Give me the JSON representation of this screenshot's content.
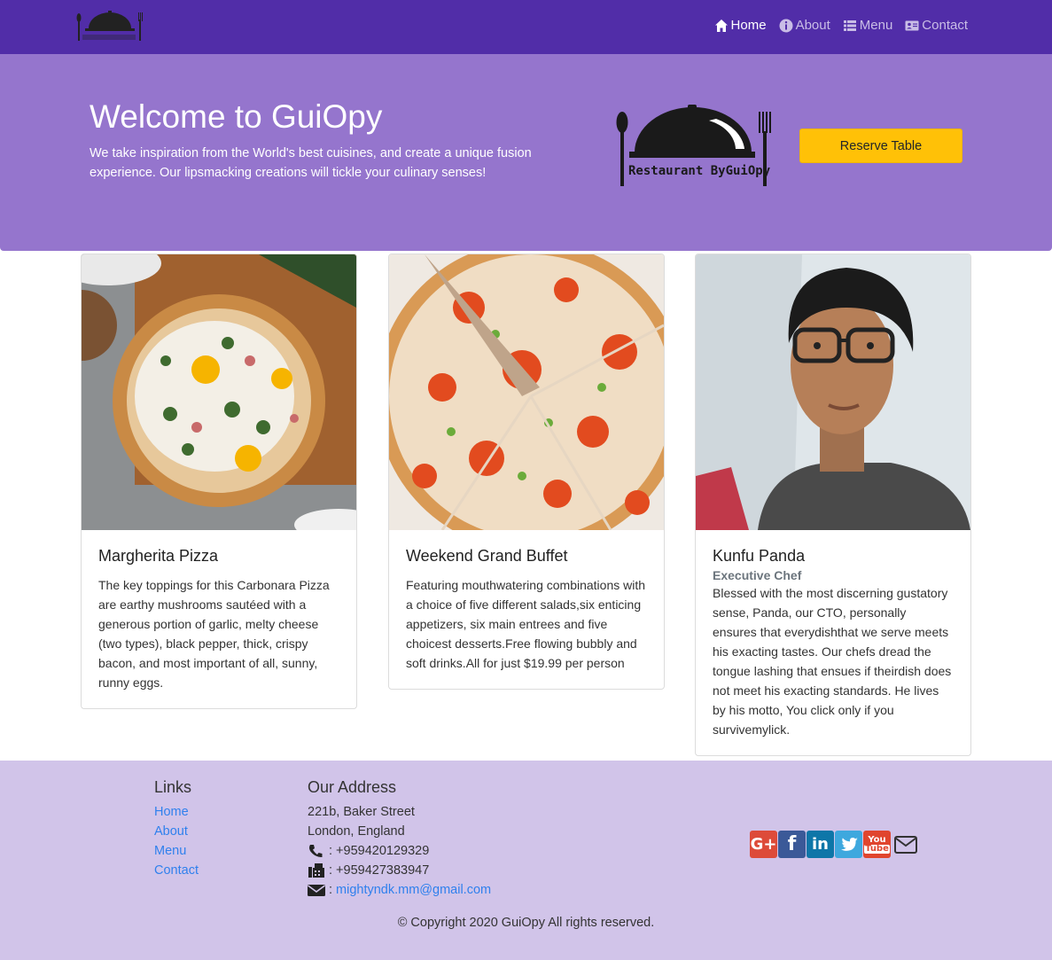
{
  "nav": {
    "brand_alt": "Restaurant ByGuiOpy",
    "items": [
      {
        "label": "Home",
        "icon": "home-icon",
        "active": true
      },
      {
        "label": "About",
        "icon": "info-icon"
      },
      {
        "label": "Menu",
        "icon": "list-icon"
      },
      {
        "label": "Contact",
        "icon": "address-card-icon"
      }
    ]
  },
  "jumbotron": {
    "title": "Welcome to GuiOpy",
    "text": "We take inspiration from the World's best cuisines, and create a unique fusion experience. Our lipsmacking creations will tickle your culinary senses!",
    "logo_text": "Restaurant ByGuiOpy",
    "button_label": "Reserve Table"
  },
  "cards": [
    {
      "title": "Margherita Pizza",
      "subtitle": "",
      "text": "The key toppings for this Carbonara Pizza are earthy mushrooms sautéed with a generous portion of garlic, melty cheese (two types), black pepper, thick, crispy bacon, and most important of all, sunny, runny eggs."
    },
    {
      "title": "Weekend Grand Buffet",
      "subtitle": "",
      "text": "Featuring mouthwatering combinations with a choice of five different salads,six enticing appetizers, six main entrees and five choicest desserts.Free flowing bubbly and soft drinks.All for just $19.99 per person"
    },
    {
      "title": "Kunfu Panda",
      "subtitle": "Executive Chef",
      "text": "Blessed with the most discerning gustatory sense, Panda, our CTO, personally ensures that everydishthat we serve meets his exacting tastes. Our chefs dread the tongue lashing that ensues if theirdish does not meet his exacting standards. He lives by his motto, You click only if you survivemylick."
    }
  ],
  "footer": {
    "links_heading": "Links",
    "links": [
      "Home",
      "About",
      "Menu",
      "Contact"
    ],
    "address_heading": "Our Address",
    "address_line1": "221b, Baker Street",
    "address_line2": "London, England",
    "phone": ": +959420129329",
    "fax": ": +959427383947",
    "email_prefix": ":",
    "email": "mightyndk.mm@gmail.com",
    "social": [
      "google-plus-icon",
      "facebook-icon",
      "linkedin-icon",
      "twitter-icon",
      "youtube-icon",
      "mail-icon"
    ],
    "copyright": "© Copyright 2020 GuiOpy All rights reserved."
  },
  "colors": {
    "navbar": "#512da8",
    "jumbotron": "#9575cd",
    "footer": "#d1c4e9",
    "button": "#ffc107",
    "link": "#2f80ed"
  }
}
